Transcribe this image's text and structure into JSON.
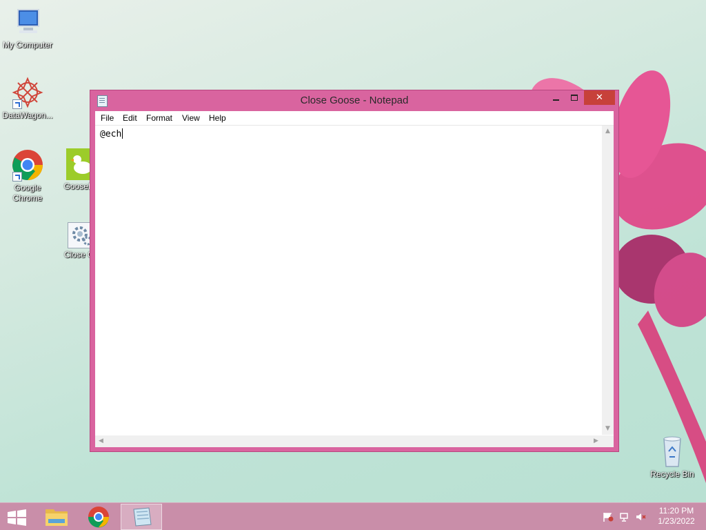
{
  "desktop": {
    "icons": [
      {
        "label": "My Computer",
        "icon": "computer-icon"
      },
      {
        "label": "DataWagon...",
        "icon": "datawagon-icon"
      },
      {
        "label": "Google Chrome",
        "icon": "chrome-icon"
      },
      {
        "label": "GooseDe",
        "icon": "goose-icon"
      },
      {
        "label": "Close Go",
        "icon": "settings-gear-icon"
      },
      {
        "label": "Recycle Bin",
        "icon": "recycle-bin-icon"
      }
    ]
  },
  "notepad": {
    "title": "Close Goose - Notepad",
    "menu": [
      "File",
      "Edit",
      "Format",
      "View",
      "Help"
    ],
    "content": "@ech",
    "controls": {
      "minimize": "minimize",
      "maximize": "maximize",
      "close": "✕"
    }
  },
  "taskbar": {
    "items": [
      "start-icon",
      "file-explorer-icon",
      "chrome-icon",
      "notepad-icon"
    ],
    "time": "11:20 PM",
    "date": "1/23/2022",
    "tray_icons": [
      "action-center-flag-icon",
      "network-icon",
      "volume-muted-icon"
    ]
  },
  "colors": {
    "window_frame": "#d9649f",
    "taskbar": "#c98ea9",
    "close_button": "#c7413a"
  }
}
